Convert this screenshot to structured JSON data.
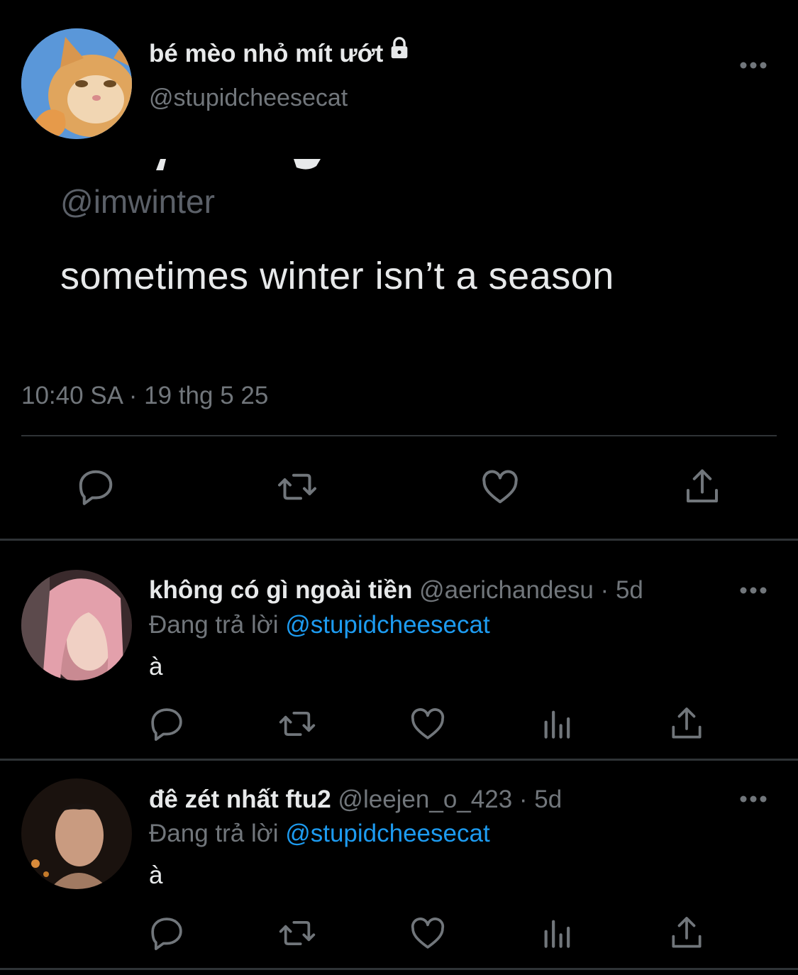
{
  "main_tweet": {
    "display_name": "bé mèo nhỏ mít ướt",
    "handle": "@stupidcheesecat",
    "quote": {
      "handle": "@imwinter",
      "text": "sometimes winter isn’t a season"
    },
    "timestamp": "10:40 SA · 19 thg 5 25",
    "actions": [
      "reply-icon",
      "retweet-icon",
      "like-icon",
      "share-icon"
    ]
  },
  "replies": [
    {
      "display_name": "không có gì ngoài tiền",
      "handle": "@aerichandesu",
      "separator": "·",
      "age": "5d",
      "replying_prefix": "Đang trả lời",
      "replying_to": "@stupidcheesecat",
      "text": "à",
      "actions": [
        "reply-icon",
        "retweet-icon",
        "like-icon",
        "views-icon",
        "share-icon"
      ]
    },
    {
      "display_name": "đê zét nhất ftu2",
      "handle": "@leejen_o_423",
      "separator": "·",
      "age": "5d",
      "replying_prefix": "Đang trả lời",
      "replying_to": "@stupidcheesecat",
      "text": "à",
      "actions": [
        "reply-icon",
        "retweet-icon",
        "like-icon",
        "views-icon",
        "share-icon"
      ]
    }
  ],
  "colors": {
    "background": "#000000",
    "primary_text": "#e7e9ea",
    "secondary_text": "#71767b",
    "link": "#1d9bf0",
    "divider": "#2f3336"
  }
}
